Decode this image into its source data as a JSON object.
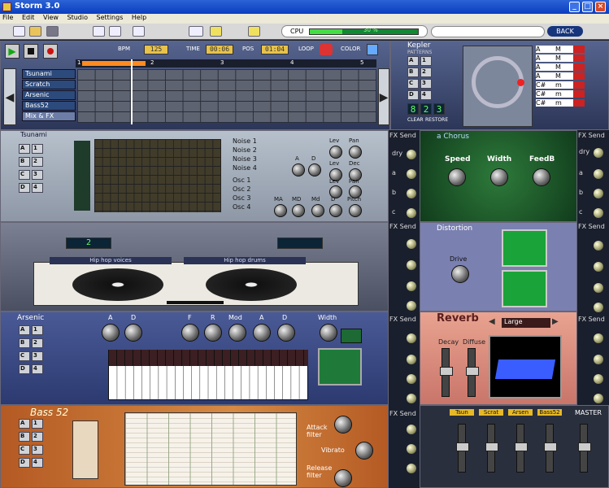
{
  "window": {
    "title": "Storm 3.0",
    "min": "_",
    "max": "□",
    "close": "×"
  },
  "menu": [
    "File",
    "Edit",
    "View",
    "Studio",
    "Settings",
    "Help"
  ],
  "toolbar": {
    "cpu_label": "CPU",
    "cpu_percent": "30 %",
    "cpu_value": 30,
    "back_label": "BACK"
  },
  "transport": {
    "bpm_label": "BPM",
    "bpm": "125",
    "time_label": "TIME",
    "time": "00:06",
    "pos_label": "POS",
    "pos": "01:04",
    "loop_label": "LOOP",
    "color_label": "COLOR"
  },
  "sequencer": {
    "tracks": [
      "Tsunami",
      "Scratch",
      "Arsenic",
      "Bass52",
      "Mix & FX"
    ],
    "bars": [
      "1",
      "2",
      "3",
      "4",
      "5"
    ]
  },
  "kepler": {
    "title": "Kepler",
    "patterns_label": "PATTERNS",
    "pads": [
      "A",
      "1",
      "B",
      "2",
      "C",
      "3",
      "D",
      "4"
    ],
    "lcd": [
      "8",
      "2",
      "3"
    ],
    "clear": "CLEAR",
    "restore": "RESTORE",
    "chords": [
      "A",
      "M",
      "A",
      "M",
      "A",
      "M",
      "A",
      "M",
      "C#",
      "m",
      "C#",
      "m",
      "C#",
      "m"
    ]
  },
  "tsunami": {
    "title": "Tsunami",
    "noises": [
      "Noise 1",
      "Noise 2",
      "Noise 3",
      "Noise 4"
    ],
    "oscs": [
      "Osc 1",
      "Osc 2",
      "Osc 3",
      "Osc 4"
    ],
    "knob_labels_top": [
      "Lev",
      "Pan",
      "A",
      "D",
      "Lev",
      "Dec"
    ],
    "knob_labels_bottom": [
      "Lev",
      "Pan",
      "MA",
      "MD",
      "Md",
      "D",
      "Pitch"
    ]
  },
  "chorus": {
    "title": "a Chorus",
    "speed": "Speed",
    "width": "Width",
    "feedb": "FeedB"
  },
  "distortion": {
    "title": "Distortion",
    "drive": "Drive"
  },
  "scratch": {
    "deck_left_label": "Hip hop voices",
    "deck_right_label": "Hip hop drums",
    "deck_left_num": "2"
  },
  "arsenic": {
    "title": "Arsenic",
    "knobs": [
      "A",
      "D",
      "F",
      "R",
      "Mod",
      "A",
      "D",
      "Width"
    ]
  },
  "reverb": {
    "title": "Reverb",
    "preset": "Large",
    "decay": "Decay",
    "diffuse": "Diffuse"
  },
  "bass52": {
    "title": "Bass 52",
    "attack": "Attack filter",
    "vibrato": "Vibrato",
    "release": "Release filter"
  },
  "fxsend": {
    "label": "FX Send",
    "dry": "dry",
    "a": "a",
    "b": "b",
    "c": "c"
  },
  "mixer": {
    "channels": [
      "Tsun",
      "Scrat",
      "Arsen",
      "Bass52",
      "MASTER"
    ]
  },
  "colors": {
    "accent_green": "#4d4",
    "chorus_bg": "#1d5a25",
    "distortion_bg": "#7a80b0",
    "reverb_bg": "#d98d80",
    "bass52_bg": "#c2672b"
  }
}
